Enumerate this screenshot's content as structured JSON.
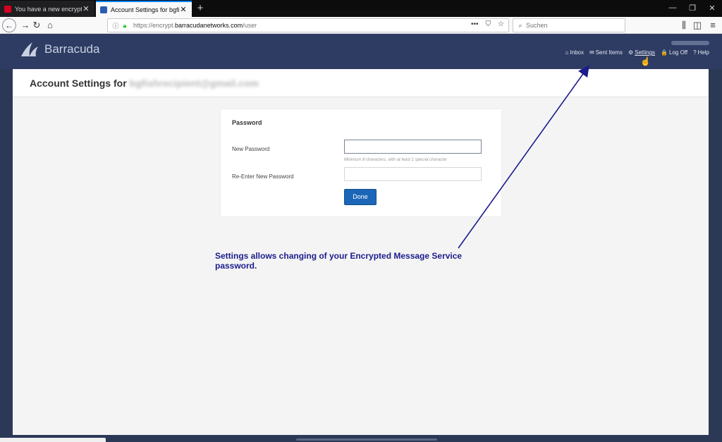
{
  "browser": {
    "tabs": [
      {
        "title": "You have a new encrypted me",
        "close": "✕",
        "favicon_color": "#d70022",
        "active": false
      },
      {
        "title": "Account Settings for bgfishrec",
        "close": "✕",
        "favicon_color": "#2a5db0",
        "active": true
      }
    ],
    "new_tab": "+",
    "window_controls": {
      "minimize": "—",
      "restore": "❐",
      "close": "✕"
    },
    "nav": {
      "back": "←",
      "forward": "→",
      "reload": "↻",
      "home": "⌂"
    },
    "url": {
      "prefix": "https://encrypt.",
      "domain": "barracudanetworks.com",
      "path": "/user"
    },
    "url_actions": {
      "more": "•••",
      "pocket": "⛉",
      "bookmark": "☆"
    },
    "search": {
      "placeholder": "Suchen",
      "icon": "search-icon"
    },
    "toolbar_right": {
      "library": "⫼",
      "sidebar": "◫",
      "menu": "≡"
    }
  },
  "app": {
    "logo_text": "Barracuda",
    "nav": [
      {
        "label": "Inbox",
        "icon": "⌂",
        "icon_name": "home-icon"
      },
      {
        "label": "Sent Items",
        "icon": "✉",
        "icon_name": "mail-icon"
      },
      {
        "label": "Settings",
        "icon": "⚙",
        "icon_name": "gear-icon",
        "active": true
      },
      {
        "label": "Log Off",
        "icon": "🔒",
        "icon_name": "lock-icon"
      },
      {
        "label": "Help",
        "icon": "?",
        "icon_name": "help-icon"
      }
    ]
  },
  "page": {
    "title": "Account Settings for",
    "email": "bgfishrecipient@gmail.com"
  },
  "password_form": {
    "section_title": "Password",
    "new_password_label": "New Password",
    "reenter_label": "Re-Enter New Password",
    "hint": "Minimum 8 characters, with at least 1 special character",
    "done_label": "Done"
  },
  "annotation": {
    "text": "Settings allows changing of your Encrypted Message Service password."
  },
  "colors": {
    "header_bg": "#2e3c63",
    "accent_button": "#1b66b7",
    "annotation": "#1c1c8c"
  }
}
